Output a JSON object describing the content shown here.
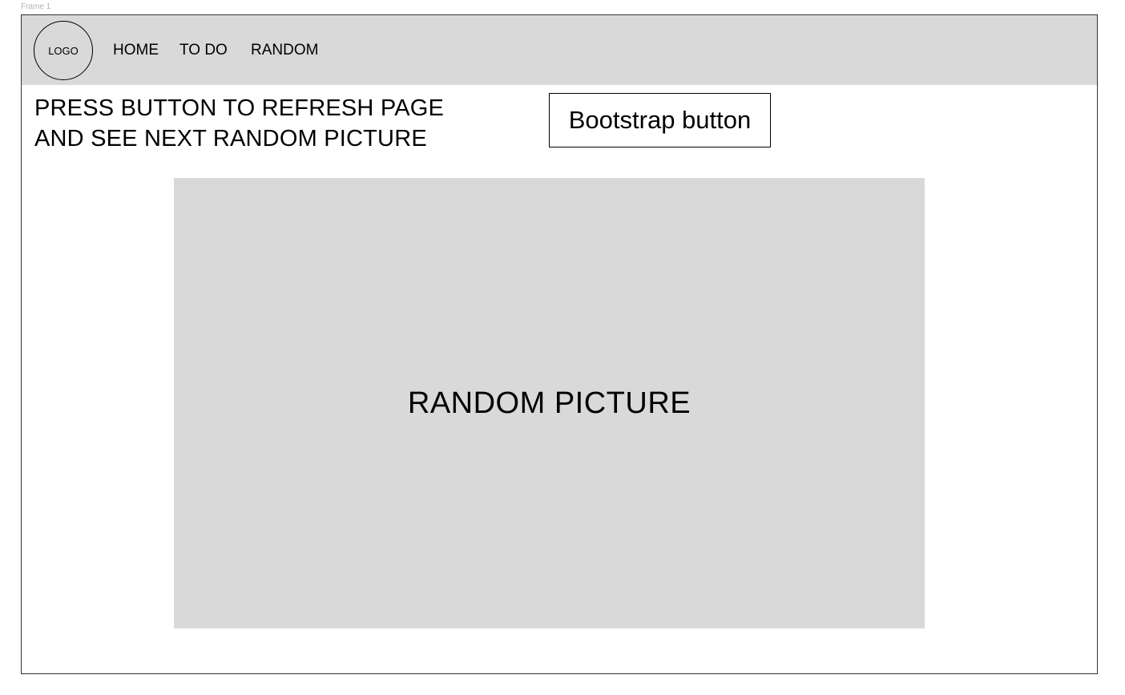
{
  "canvas": {
    "frame_label": "Frame 1"
  },
  "navbar": {
    "logo_text": "LOGO",
    "items": [
      {
        "label": "HOME"
      },
      {
        "label": "TO DO"
      },
      {
        "label": "RANDOM"
      }
    ]
  },
  "main": {
    "instructions_line1": "PRESS BUTTON TO REFRESH PAGE",
    "instructions_line2": "AND SEE NEXT RANDOM PICTURE",
    "button_label": "Bootstrap button",
    "picture_label": "RANDOM PICTURE"
  },
  "colors": {
    "navbar_bg": "#d9d9d9",
    "picture_bg": "#d9d9d9",
    "border": "#333333"
  }
}
